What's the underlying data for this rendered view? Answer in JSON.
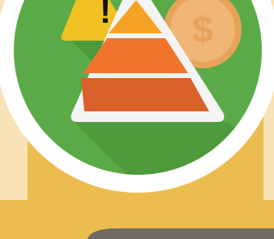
{
  "icon": {
    "name": "risk-pyramid-icon",
    "warning_symbol": "!",
    "coin_symbol": "$"
  },
  "colors": {
    "background_gold": "#ebbd4f",
    "panel_cream": "#f7e3b6",
    "circle_border": "#ffffff",
    "circle_green": "#5aab47",
    "long_shadow": "#4f9a3c",
    "warning_yellow": "#f0c120",
    "coin_outer": "#e8a35a",
    "coin_inner": "#f0b676",
    "pyramid_outline": "#f4f4f4",
    "pyramid_top": "#f6a325",
    "pyramid_middle": "#f0752b",
    "pyramid_bottom": "#d9612a",
    "button_edge": "#6f6a62"
  }
}
